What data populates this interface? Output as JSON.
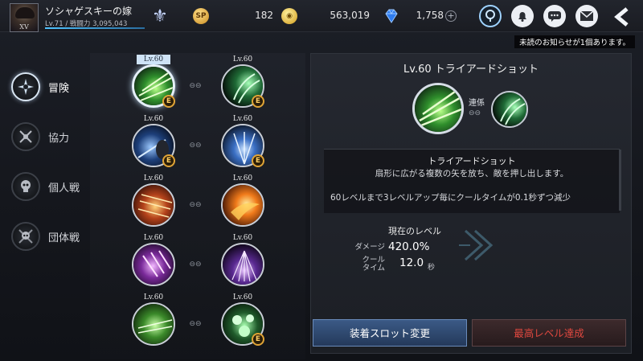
{
  "header": {
    "player_name": "ソシャゲスキーの嫁",
    "player_level_line": "Lv.71 / 戦闘力 3,095,043",
    "rank_label": "XV",
    "sp_icon_label": "SP",
    "sp_amount": "182",
    "gold_amount": "563,019",
    "gem_amount": "1,758",
    "gem_add": "+",
    "notice": "未読のお知らせが1個あります。"
  },
  "nav": {
    "items": [
      {
        "label": "冒険",
        "active": true
      },
      {
        "label": "協力",
        "active": false
      },
      {
        "label": "個人戦",
        "active": false
      },
      {
        "label": "団体戦",
        "active": false
      }
    ]
  },
  "skills": {
    "rows": [
      {
        "left": {
          "level": "Lv.60",
          "badge": "E",
          "theme": "green-arrow"
        },
        "right": {
          "level": "Lv.60",
          "badge": "E",
          "theme": "green-swirl"
        }
      },
      {
        "left": {
          "level": "Lv.60",
          "badge": "E",
          "theme": "blue-figure"
        },
        "right": {
          "level": "Lv.60",
          "badge": "E",
          "theme": "blue-burst"
        }
      },
      {
        "left": {
          "level": "Lv.60",
          "badge": "",
          "theme": "fire-rain"
        },
        "right": {
          "level": "Lv.60",
          "badge": "",
          "theme": "fire-bird"
        }
      },
      {
        "left": {
          "level": "Lv.60",
          "badge": "",
          "theme": "purple-claw"
        },
        "right": {
          "level": "Lv.60",
          "badge": "",
          "theme": "purple-rain"
        }
      },
      {
        "left": {
          "level": "Lv.60",
          "badge": "",
          "theme": "green-wind"
        },
        "right": {
          "level": "Lv.60",
          "badge": "E",
          "theme": "green-orbs"
        }
      }
    ],
    "link_glyph": "⊖⊖"
  },
  "detail": {
    "title": "Lv.60 トライアードショット",
    "chain_label": "連係",
    "skill_name": "トライアードショット",
    "description": "扇形に広がる複数の矢を放ち、敵を押し出します。",
    "note": "60レベルまで3レベルアップ毎にクールタイムが0.1秒ずつ減少",
    "current_level_label": "現在のレベル",
    "damage_label": "ダメージ",
    "damage_value": "420.0%",
    "cooltime_label_1": "クール",
    "cooltime_label_2": "タイム",
    "cooltime_value": "12.0",
    "cooltime_unit": "秒",
    "equip_button": "装着スロット変更",
    "max_level_button": "最高レベル達成"
  },
  "colors": {
    "accent_blue": "#4fc3ff",
    "badge_gold": "#e0a436",
    "max_level_red": "#e0483f",
    "equip_blue": "#3b5a86"
  }
}
